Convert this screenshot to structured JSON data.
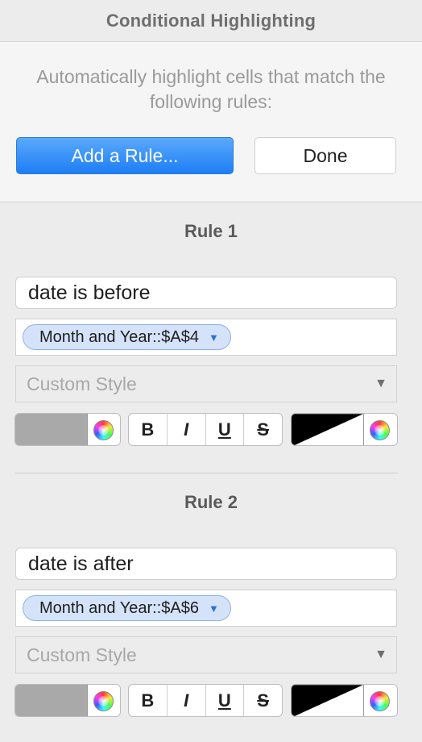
{
  "header": {
    "title": "Conditional Highlighting"
  },
  "intro": {
    "description": "Automatically highlight cells that match the following rules:",
    "add_rule_label": "Add a Rule...",
    "done_label": "Done"
  },
  "rules": [
    {
      "title": "Rule 1",
      "condition": "date is before",
      "token": "Month and Year::$A$4",
      "style_placeholder": "Custom Style",
      "format": {
        "bold": "B",
        "italic": "I",
        "underline": "U",
        "strike": "S"
      },
      "fill_color": "#a9a9a9",
      "text_color": "#000000"
    },
    {
      "title": "Rule 2",
      "condition": "date is after",
      "token": "Month and Year::$A$6",
      "style_placeholder": "Custom Style",
      "format": {
        "bold": "B",
        "italic": "I",
        "underline": "U",
        "strike": "S"
      },
      "fill_color": "#a9a9a9",
      "text_color": "#000000"
    }
  ],
  "colors": {
    "accent": "#1d7ef5",
    "token_bg": "#d4e3f9",
    "token_border": "#8fb1e8"
  }
}
